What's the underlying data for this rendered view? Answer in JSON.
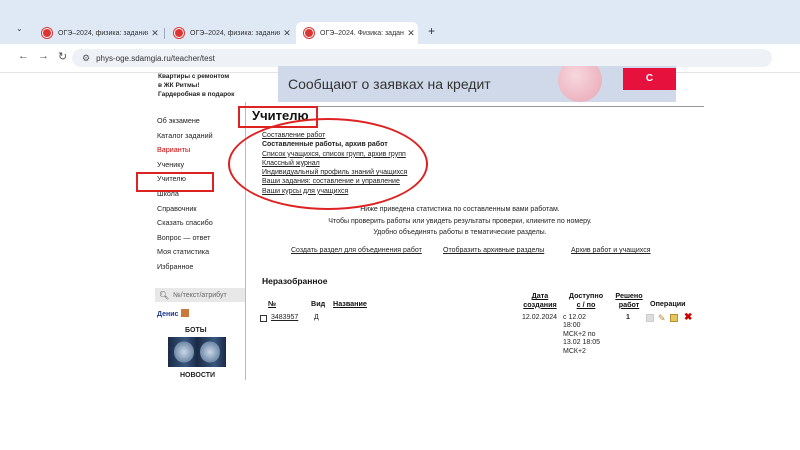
{
  "browser": {
    "tabs": [
      {
        "title": "ОГЭ–2024, физика: задания, о"
      },
      {
        "title": "ОГЭ–2024, физика: задания, о"
      },
      {
        "title": "ОГЭ–2024. Физика: задания, о"
      }
    ],
    "new_tab": "+",
    "url": "phys-oge.sdamgia.ru/teacher/test",
    "nav": {
      "back": "←",
      "forward": "→",
      "reload": "↻"
    }
  },
  "ad": {
    "left_text": [
      "Квартиры с ремонтом",
      "в ЖК Ритмы!",
      "Гардеробная в подарок"
    ],
    "banner_text": "Сообщают о заявках на кредит",
    "banner_button": "С"
  },
  "sidebar": {
    "items": [
      {
        "label": "Об экзамене"
      },
      {
        "label": "Каталог заданий"
      },
      {
        "label": "Варианты",
        "color": "#cc0000"
      },
      {
        "label": "Ученику"
      },
      {
        "label": "Учителю"
      },
      {
        "label": "Школа"
      },
      {
        "label": "Справочник"
      },
      {
        "label": "Сказать спасибо"
      },
      {
        "label": "Вопрос — ответ"
      },
      {
        "label": "Моя статистика"
      },
      {
        "label": "Избранное"
      }
    ],
    "search_placeholder": "№/текст/атрибут",
    "user": "Денис",
    "bots_label": "БОТЫ",
    "news_label": "НОВОСТИ"
  },
  "main": {
    "title": "Учителю",
    "links": [
      {
        "label": "Составление работ"
      },
      {
        "label": "Составленные работы, архив работ",
        "bold": true
      },
      {
        "label": "Список учащихся, список групп, архив групп"
      },
      {
        "label": "Классный журнал"
      },
      {
        "label": "Индивидуальный профиль знаний учащихся"
      },
      {
        "label": "Ваши задания: составление и управление"
      },
      {
        "label": "Ваши курсы для учащихся"
      }
    ],
    "info_lines": [
      "Ниже приведена статистика по составленным вами работам.",
      "Чтобы проверить работы или увидеть результаты проверки, кликните по номеру.",
      "Удобно объединять работы в тематические разделы."
    ],
    "actions": [
      {
        "label": "Создать раздел для объединения работ"
      },
      {
        "label": "Отобразить архивные разделы"
      },
      {
        "label": "Архив работ и учащихся"
      }
    ],
    "panel": {
      "title": "Неразобранное",
      "headers": {
        "num": "№",
        "kind": "Вид",
        "name": "Название",
        "date": [
          "Дата",
          "создания"
        ],
        "access": [
          "Доступно",
          "с / по"
        ],
        "solved": [
          "Решено",
          "работ"
        ],
        "ops": "Операции"
      },
      "rows": [
        {
          "num": "3483957",
          "kind": "Д",
          "name": "",
          "date": "12.02.2024",
          "access": [
            "с 12.02",
            "18:00",
            "МСК+2 по",
            "13.02 18:05",
            "МСК+2"
          ],
          "solved": "1"
        }
      ]
    }
  },
  "colors": {
    "highlight": "#dd2222",
    "link": "#222222",
    "accent_red": "#cc0000"
  }
}
